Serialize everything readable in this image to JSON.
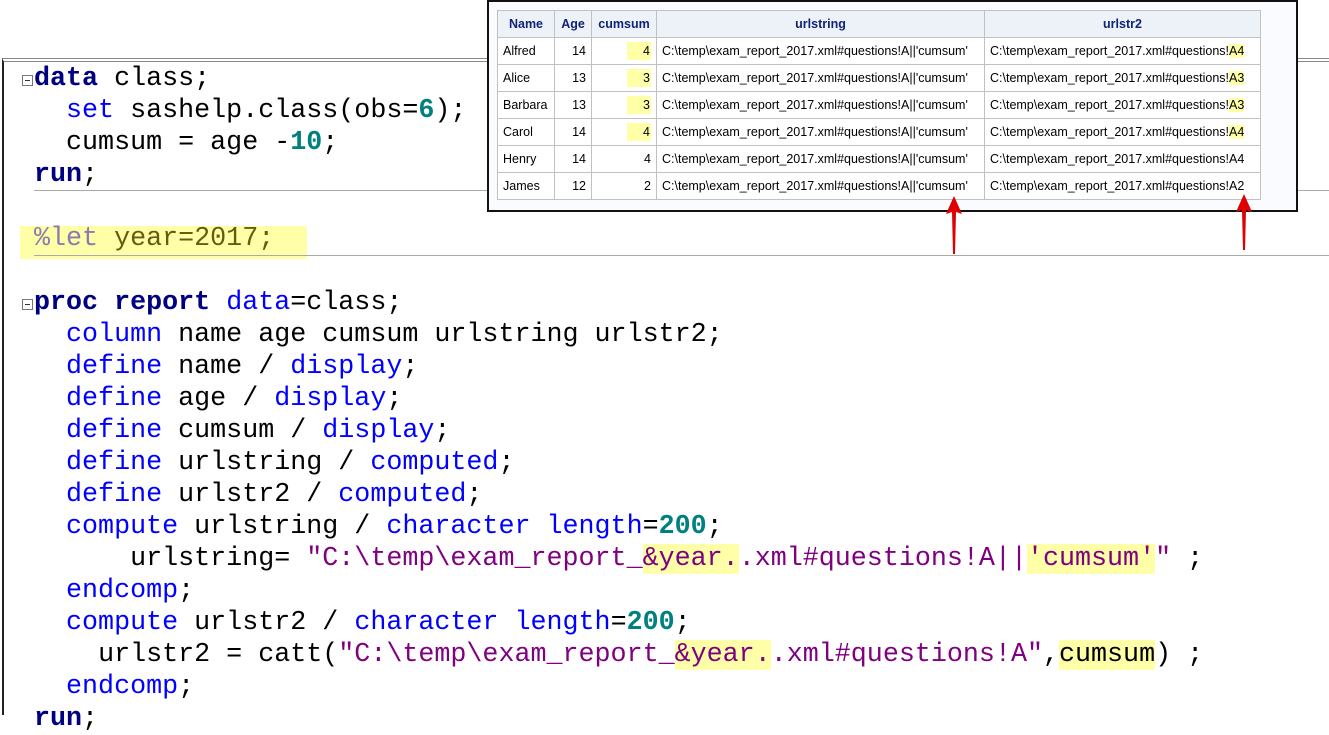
{
  "code": [
    {
      "indent": "",
      "tokens": [
        [
          "data",
          "kw"
        ],
        [
          " class;",
          "pl"
        ]
      ],
      "fold": true
    },
    {
      "indent": "  ",
      "tokens": [
        [
          "set",
          "bl"
        ],
        [
          " sashelp.class(obs=",
          "pl"
        ],
        [
          "6",
          "num"
        ],
        [
          ");",
          "pl"
        ]
      ]
    },
    {
      "indent": "  ",
      "tokens": [
        [
          "cumsum = age -",
          "pl"
        ],
        [
          "10",
          "num"
        ],
        [
          ";",
          "pl"
        ]
      ]
    },
    {
      "indent": "",
      "tokens": [
        [
          "run",
          "kw"
        ],
        [
          ";",
          "pl"
        ]
      ]
    },
    {
      "indent": "",
      "tokens": []
    },
    {
      "indent": "",
      "tokens": [
        [
          "%let",
          "mac"
        ],
        [
          " year=2017;",
          "let"
        ]
      ]
    },
    {
      "indent": "",
      "tokens": [
        [
          "proc report",
          "kw"
        ],
        [
          " ",
          "pl"
        ],
        [
          "data",
          "bl"
        ],
        [
          "=class;",
          "pl"
        ]
      ],
      "fold": true
    },
    {
      "indent": "  ",
      "tokens": [
        [
          "column",
          "bl"
        ],
        [
          " name age cumsum urlstring urlstr2;",
          "pl"
        ]
      ]
    },
    {
      "indent": "  ",
      "tokens": [
        [
          "define",
          "bl"
        ],
        [
          " name / ",
          "pl"
        ],
        [
          "display",
          "bl"
        ],
        [
          ";",
          "pl"
        ]
      ]
    },
    {
      "indent": "  ",
      "tokens": [
        [
          "define",
          "bl"
        ],
        [
          " age / ",
          "pl"
        ],
        [
          "display",
          "bl"
        ],
        [
          ";",
          "pl"
        ]
      ]
    },
    {
      "indent": "  ",
      "tokens": [
        [
          "define",
          "bl"
        ],
        [
          " cumsum / ",
          "pl"
        ],
        [
          "display",
          "bl"
        ],
        [
          ";",
          "pl"
        ]
      ]
    },
    {
      "indent": "  ",
      "tokens": [
        [
          "define",
          "bl"
        ],
        [
          " urlstring / ",
          "pl"
        ],
        [
          "computed",
          "bl"
        ],
        [
          ";",
          "pl"
        ]
      ]
    },
    {
      "indent": "  ",
      "tokens": [
        [
          "define",
          "bl"
        ],
        [
          " urlstr2 / ",
          "pl"
        ],
        [
          "computed",
          "bl"
        ],
        [
          ";",
          "pl"
        ]
      ]
    },
    {
      "indent": "  ",
      "tokens": [
        [
          "compute",
          "bl"
        ],
        [
          " urlstring / ",
          "pl"
        ],
        [
          "character length",
          "bl"
        ],
        [
          "=",
          "pl"
        ],
        [
          "200",
          "num"
        ],
        [
          ";",
          "pl"
        ]
      ]
    },
    {
      "indent": "      ",
      "tokens": [
        [
          "urlstring= ",
          "pl"
        ],
        [
          "\"C:\\temp\\exam_report_",
          "str"
        ],
        [
          "&year.",
          "str hl"
        ],
        [
          ".xml#questions!A||",
          "str"
        ],
        [
          "'cumsum'",
          "str hl"
        ],
        [
          "\"",
          "str"
        ],
        [
          " ;",
          "pl"
        ]
      ]
    },
    {
      "indent": "  ",
      "tokens": [
        [
          "endcomp",
          "bl"
        ],
        [
          ";",
          "pl"
        ]
      ]
    },
    {
      "indent": "  ",
      "tokens": [
        [
          "compute",
          "bl"
        ],
        [
          " urlstr2 / ",
          "pl"
        ],
        [
          "character length",
          "bl"
        ],
        [
          "=",
          "pl"
        ],
        [
          "200",
          "num"
        ],
        [
          ";",
          "pl"
        ]
      ]
    },
    {
      "indent": "    ",
      "tokens": [
        [
          "urlstr2 = catt(",
          "pl"
        ],
        [
          "\"C:\\temp\\exam_report_",
          "str"
        ],
        [
          "&year.",
          "str hl"
        ],
        [
          ".xml#questions!A\"",
          "str"
        ],
        [
          ",",
          "pl"
        ],
        [
          "cumsum",
          "pl hl"
        ],
        [
          ") ;",
          "pl"
        ]
      ]
    },
    {
      "indent": "  ",
      "tokens": [
        [
          "endcomp",
          "bl"
        ],
        [
          ";",
          "pl"
        ]
      ]
    },
    {
      "indent": "",
      "tokens": [
        [
          "run",
          "kw"
        ],
        [
          ";",
          "pl"
        ]
      ]
    }
  ],
  "report": {
    "headers": [
      "Name",
      "Age",
      "cumsum",
      "urlstring",
      "urlstr2"
    ],
    "rows": [
      {
        "name": "Alfred",
        "age": "14",
        "cumsum": "4",
        "hl": true,
        "urlstring": "C:\\temp\\exam_report_2017.xml#questions!A||'cumsum'",
        "urlstr2_base": "C:\\temp\\exam_report_2017.xml#questions!",
        "urlstr2_cell": "A4"
      },
      {
        "name": "Alice",
        "age": "13",
        "cumsum": "3",
        "hl": true,
        "urlstring": "C:\\temp\\exam_report_2017.xml#questions!A||'cumsum'",
        "urlstr2_base": "C:\\temp\\exam_report_2017.xml#questions!",
        "urlstr2_cell": "A3"
      },
      {
        "name": "Barbara",
        "age": "13",
        "cumsum": "3",
        "hl": true,
        "urlstring": "C:\\temp\\exam_report_2017.xml#questions!A||'cumsum'",
        "urlstr2_base": "C:\\temp\\exam_report_2017.xml#questions!",
        "urlstr2_cell": "A3"
      },
      {
        "name": "Carol",
        "age": "14",
        "cumsum": "4",
        "hl": true,
        "urlstring": "C:\\temp\\exam_report_2017.xml#questions!A||'cumsum'",
        "urlstr2_base": "C:\\temp\\exam_report_2017.xml#questions!",
        "urlstr2_cell": "A4"
      },
      {
        "name": "Henry",
        "age": "14",
        "cumsum": "4",
        "hl": false,
        "urlstring": "C:\\temp\\exam_report_2017.xml#questions!A||'cumsum'",
        "urlstr2_base": "C:\\temp\\exam_report_2017.xml#questions!",
        "urlstr2_cell": "A4"
      },
      {
        "name": "James",
        "age": "12",
        "cumsum": "2",
        "hl": false,
        "urlstring": "C:\\temp\\exam_report_2017.xml#questions!A||'cumsum'",
        "urlstr2_base": "C:\\temp\\exam_report_2017.xml#questions!",
        "urlstr2_cell": "A2"
      }
    ]
  },
  "colors": {
    "highlight": "#ffffa8",
    "arrow": "#e00000",
    "keyword": "#000080",
    "string": "#800080",
    "number": "#008080"
  }
}
